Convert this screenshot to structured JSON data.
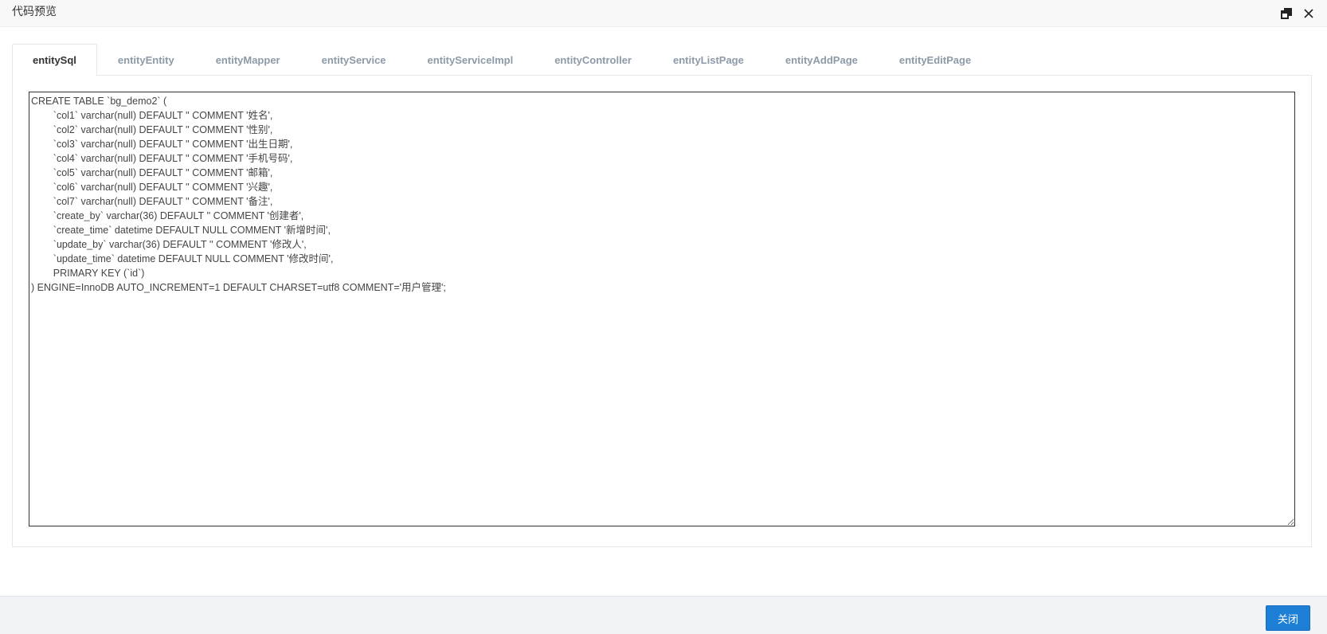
{
  "dialog": {
    "title": "代码预览",
    "controls": {
      "maximize_icon": "restore-window-icon",
      "close_icon": "close-icon"
    }
  },
  "tabs": [
    {
      "label": "entitySql",
      "active": true
    },
    {
      "label": "entityEntity",
      "active": false
    },
    {
      "label": "entityMapper",
      "active": false
    },
    {
      "label": "entityService",
      "active": false
    },
    {
      "label": "entityServiceImpl",
      "active": false
    },
    {
      "label": "entityController",
      "active": false
    },
    {
      "label": "entityListPage",
      "active": false
    },
    {
      "label": "entityAddPage",
      "active": false
    },
    {
      "label": "entityEditPage",
      "active": false
    }
  ],
  "code": {
    "content": "CREATE TABLE `bg_demo2` (\n        `col1` varchar(null) DEFAULT '' COMMENT '姓名',\n        `col2` varchar(null) DEFAULT '' COMMENT '性别',\n        `col3` varchar(null) DEFAULT '' COMMENT '出生日期',\n        `col4` varchar(null) DEFAULT '' COMMENT '手机号码',\n        `col5` varchar(null) DEFAULT '' COMMENT '邮箱',\n        `col6` varchar(null) DEFAULT '' COMMENT '兴趣',\n        `col7` varchar(null) DEFAULT '' COMMENT '备注',\n        `create_by` varchar(36) DEFAULT '' COMMENT '创建者',\n        `create_time` datetime DEFAULT NULL COMMENT '新增时间',\n        `update_by` varchar(36) DEFAULT '' COMMENT '修改人',\n        `update_time` datetime DEFAULT NULL COMMENT '修改时间',\n        PRIMARY KEY (`id`)\n) ENGINE=InnoDB AUTO_INCREMENT=1 DEFAULT CHARSET=utf8 COMMENT='用户管理';"
  },
  "footer": {
    "close_label": "关闭"
  },
  "colors": {
    "primary_button": "#1e7fd7",
    "active_tab_text": "#333333",
    "inactive_tab_text": "#8d9aa8"
  }
}
